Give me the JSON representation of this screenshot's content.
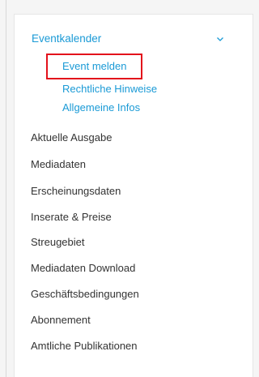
{
  "nav": {
    "section_title": "Eventkalender",
    "section_chevron": "chevron-down-icon",
    "sub_items": [
      {
        "label": "Event melden",
        "highlighted": true
      },
      {
        "label": "Rechtliche Hinweise"
      },
      {
        "label": "Allgemeine Infos"
      }
    ],
    "items": [
      {
        "label": "Aktuelle Ausgabe"
      },
      {
        "label": "Mediadaten"
      },
      {
        "label": "Erscheinungsdaten"
      },
      {
        "label": "Inserate & Preise"
      },
      {
        "label": "Streugebiet"
      },
      {
        "label": "Mediadaten Download"
      },
      {
        "label": "Geschäftsbedingungen"
      },
      {
        "label": "Abonnement"
      },
      {
        "label": "Amtliche Publikationen"
      }
    ]
  },
  "colors": {
    "link": "#1a9ad6",
    "text": "#333333",
    "highlight_border": "#e3111b"
  }
}
